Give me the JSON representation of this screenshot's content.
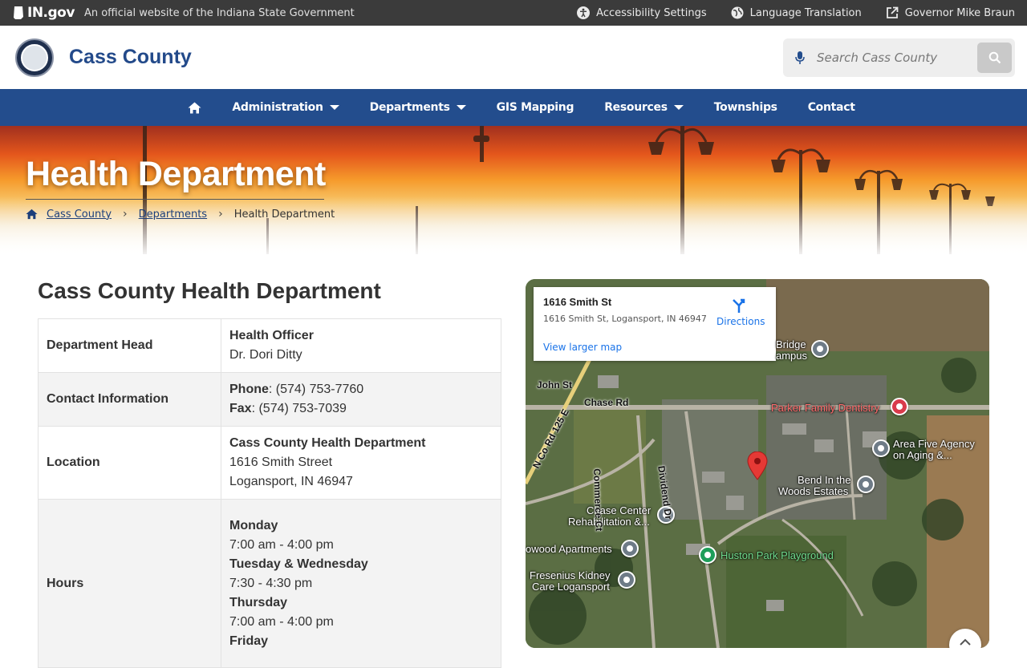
{
  "topbar": {
    "logo": "IN.gov",
    "official_text": "An official website of the Indiana State Government",
    "links": [
      {
        "label": "Accessibility Settings",
        "icon": "accessibility-icon"
      },
      {
        "label": "Language Translation",
        "icon": "globe-icon"
      },
      {
        "label": "Governor Mike Braun",
        "icon": "external-link-icon"
      }
    ]
  },
  "header": {
    "site_title": "Cass County",
    "search_placeholder": "Search Cass County"
  },
  "nav": {
    "items": [
      {
        "label": "Administration",
        "has_menu": true
      },
      {
        "label": "Departments",
        "has_menu": true
      },
      {
        "label": "GIS Mapping",
        "has_menu": false
      },
      {
        "label": "Resources",
        "has_menu": true
      },
      {
        "label": "Townships",
        "has_menu": false
      },
      {
        "label": "Contact",
        "has_menu": false
      }
    ]
  },
  "hero": {
    "title": "Health Department",
    "breadcrumbs": [
      "Cass County",
      "Departments",
      "Health Department"
    ]
  },
  "content": {
    "title": "Cass County Health Department",
    "rows": {
      "head": {
        "label": "Department Head",
        "title": "Health Officer",
        "name": "Dr. Dori Ditty"
      },
      "contact": {
        "label": "Contact Information",
        "phone_label": "Phone",
        "phone": ": (574) 753-7760",
        "fax_label": "Fax",
        "fax": ": (574) 753-7039"
      },
      "location": {
        "label": "Location",
        "name": "Cass County Health Department",
        "street": "1616 Smith Street",
        "city": "Logansport, IN 46947"
      },
      "hours": {
        "label": "Hours",
        "days": [
          {
            "day": "Monday",
            "time": "7:00 am - 4:00 pm"
          },
          {
            "day": "Tuesday & Wednesday",
            "time": "7:30 - 4:30 pm"
          },
          {
            "day": "Thursday",
            "time": "7:00 am - 4:00 pm"
          },
          {
            "day": "Friday",
            "time": ""
          }
        ]
      }
    }
  },
  "map": {
    "place_name": "1616 Smith St",
    "address": "1616 Smith St, Logansport, IN 46947",
    "directions_label": "Directions",
    "larger_map_label": "View larger map",
    "labels": {
      "bridge": "Bridge",
      "campus": "ampus",
      "john_st": "John St",
      "chase_rd": "Chase Rd",
      "parker": "Parker Family Dentistry",
      "area_five_1": "Area Five Agency",
      "area_five_2": "on Aging &...",
      "bend_1": "Bend In the",
      "bend_2": "Woods Estates",
      "chase_center_1": "Chase Center",
      "chase_center_2": "Rehabilitation &...",
      "apartments": "owood Apartments",
      "huston": "Huston Park Playground",
      "fresenius_1": "Fresenius Kidney",
      "fresenius_2": "Care Logansport",
      "commerce": "Commerce Ct",
      "dividend": "Dividend Dr",
      "n_co_rd": "N Co Rd 125 E"
    }
  }
}
